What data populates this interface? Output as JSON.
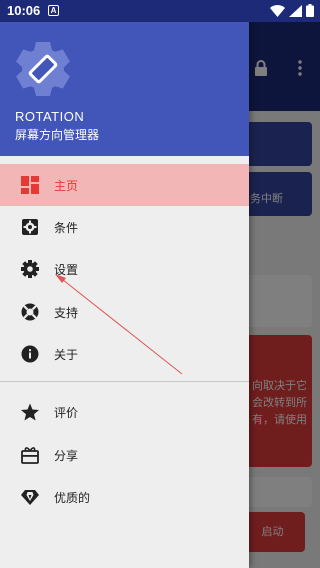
{
  "status_bar": {
    "time": "10:06",
    "notification_letter": "A"
  },
  "background_app": {
    "card_text": "务中断",
    "warning_text": "向取决于它会改转到所有，请使用",
    "start_button": "启动"
  },
  "drawer": {
    "app_name": "ROTATION",
    "app_subtitle": "屏幕方向管理器",
    "menu": [
      {
        "label": "主页",
        "icon": "dashboard-icon",
        "active": true
      },
      {
        "label": "条件",
        "icon": "conditions-icon"
      },
      {
        "label": "设置",
        "icon": "gear-icon"
      },
      {
        "label": "支持",
        "icon": "support-icon"
      },
      {
        "label": "关于",
        "icon": "info-icon"
      }
    ],
    "secondary_menu": [
      {
        "label": "评价",
        "icon": "star-icon"
      },
      {
        "label": "分享",
        "icon": "gift-icon"
      },
      {
        "label": "优质的",
        "icon": "diamond-icon"
      }
    ]
  },
  "colors": {
    "accent_red": "#e53935",
    "header_blue": "#4255b8",
    "toolbar_blue": "#1d2a78"
  }
}
